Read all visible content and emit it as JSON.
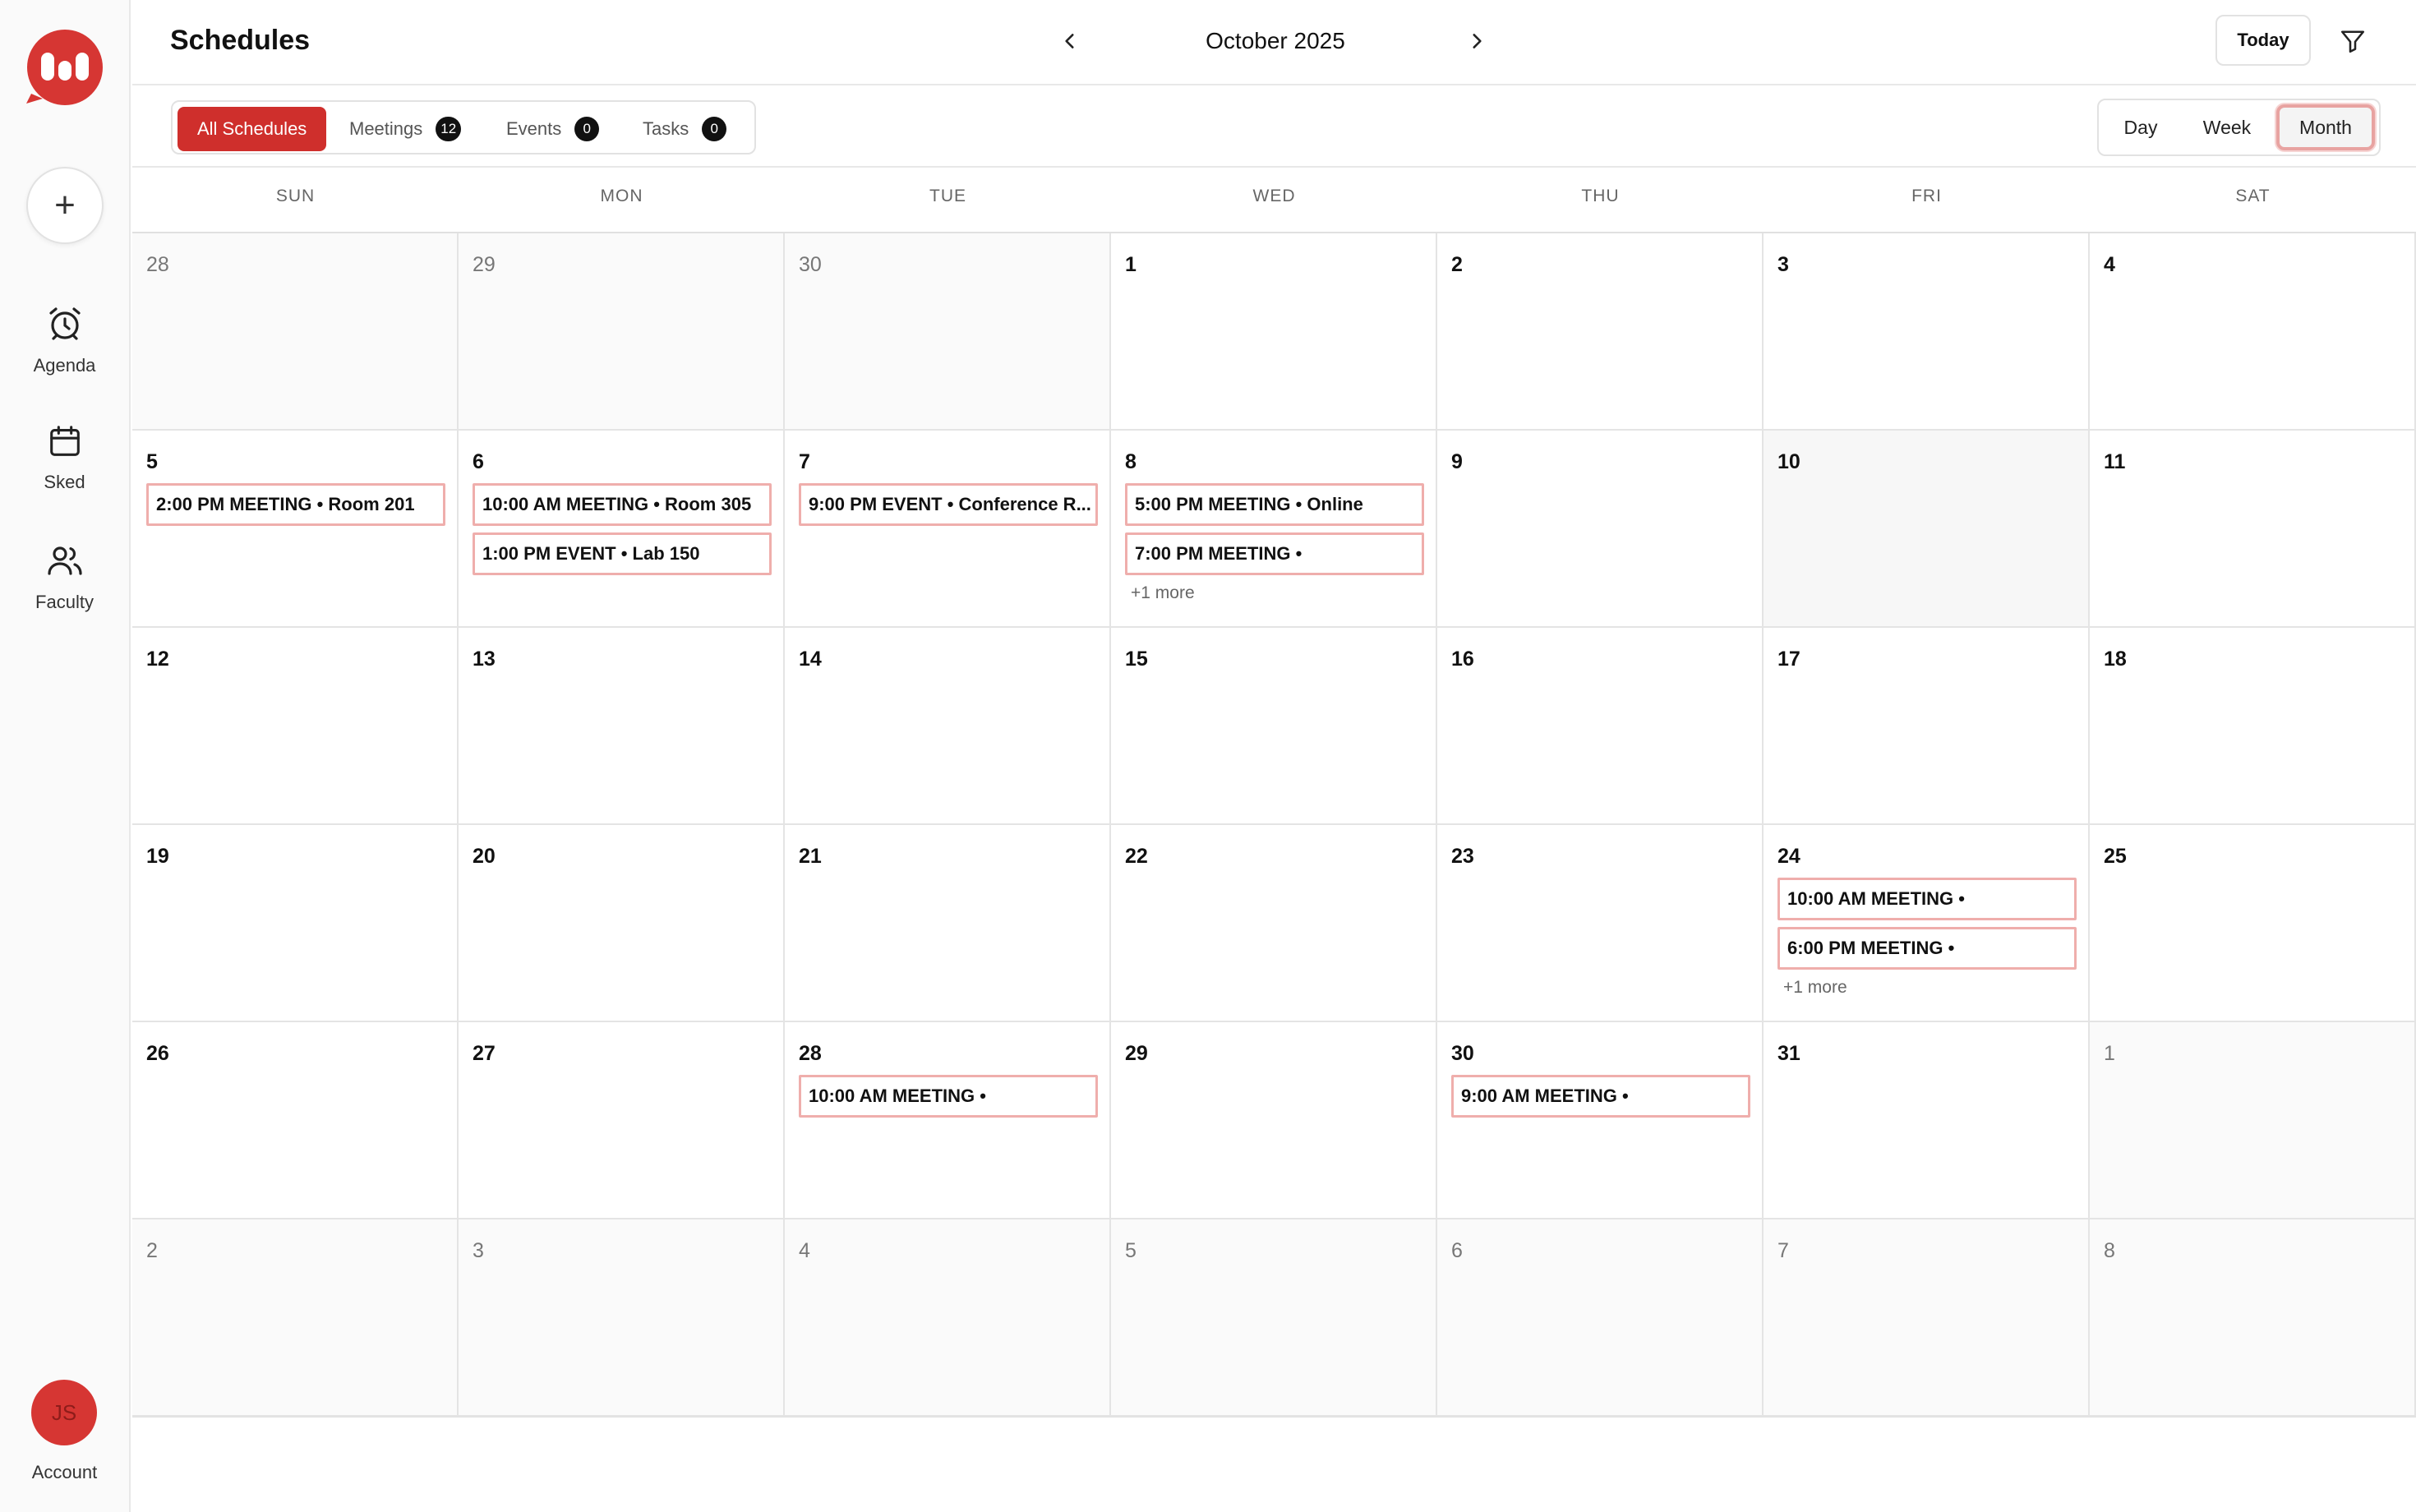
{
  "app": {
    "title": "Schedules",
    "brand_color": "#cf2f2c",
    "accent_border": "#efaeac"
  },
  "sidebar": {
    "add_icon": "plus-icon",
    "items": [
      {
        "label": "Agenda",
        "icon": "alarm-clock-icon"
      },
      {
        "label": "Sked",
        "icon": "calendar-icon"
      },
      {
        "label": "Faculty",
        "icon": "users-icon"
      }
    ],
    "account": {
      "initials": "JS",
      "label": "Account"
    }
  },
  "header": {
    "month": "October 2025",
    "prev_icon": "chevron-left-icon",
    "next_icon": "chevron-right-icon",
    "today_label": "Today",
    "filter_icon": "filter-icon"
  },
  "filters": [
    {
      "label": "All Schedules",
      "active": true
    },
    {
      "label": "Meetings",
      "count": "12"
    },
    {
      "label": "Events",
      "count": "0"
    },
    {
      "label": "Tasks",
      "count": "0"
    }
  ],
  "views": [
    "Day",
    "Week",
    "Month"
  ],
  "active_view": "Month",
  "weekdays": [
    "SUN",
    "MON",
    "TUE",
    "WED",
    "THU",
    "FRI",
    "SAT"
  ],
  "weeks": [
    [
      {
        "day": "28",
        "muted": true
      },
      {
        "day": "29",
        "muted": true
      },
      {
        "day": "30",
        "muted": true
      },
      {
        "day": "1"
      },
      {
        "day": "2"
      },
      {
        "day": "3"
      },
      {
        "day": "4"
      }
    ],
    [
      {
        "day": "5",
        "events": [
          "2:00 PM MEETING • Room 201"
        ]
      },
      {
        "day": "6",
        "events": [
          "10:00 AM MEETING • Room 305",
          "1:00 PM EVENT • Lab 150"
        ]
      },
      {
        "day": "7",
        "events": [
          "9:00 PM EVENT • Conference R..."
        ]
      },
      {
        "day": "8",
        "events": [
          "5:00 PM MEETING • Online",
          "7:00 PM MEETING •"
        ],
        "more": "+1 more"
      },
      {
        "day": "9"
      },
      {
        "day": "10",
        "today": true
      },
      {
        "day": "11"
      }
    ],
    [
      {
        "day": "12"
      },
      {
        "day": "13"
      },
      {
        "day": "14"
      },
      {
        "day": "15"
      },
      {
        "day": "16"
      },
      {
        "day": "17"
      },
      {
        "day": "18"
      }
    ],
    [
      {
        "day": "19"
      },
      {
        "day": "20"
      },
      {
        "day": "21"
      },
      {
        "day": "22"
      },
      {
        "day": "23"
      },
      {
        "day": "24",
        "events": [
          "10:00 AM MEETING •",
          "6:00 PM MEETING •"
        ],
        "more": "+1 more"
      },
      {
        "day": "25"
      }
    ],
    [
      {
        "day": "26"
      },
      {
        "day": "27"
      },
      {
        "day": "28",
        "events": [
          "10:00 AM MEETING •"
        ]
      },
      {
        "day": "29"
      },
      {
        "day": "30",
        "events": [
          "9:00 AM MEETING •"
        ]
      },
      {
        "day": "31"
      },
      {
        "day": "1",
        "muted": true
      }
    ],
    [
      {
        "day": "2",
        "muted": true
      },
      {
        "day": "3",
        "muted": true
      },
      {
        "day": "4",
        "muted": true
      },
      {
        "day": "5",
        "muted": true
      },
      {
        "day": "6",
        "muted": true
      },
      {
        "day": "7",
        "muted": true
      },
      {
        "day": "8",
        "muted": true
      }
    ]
  ]
}
